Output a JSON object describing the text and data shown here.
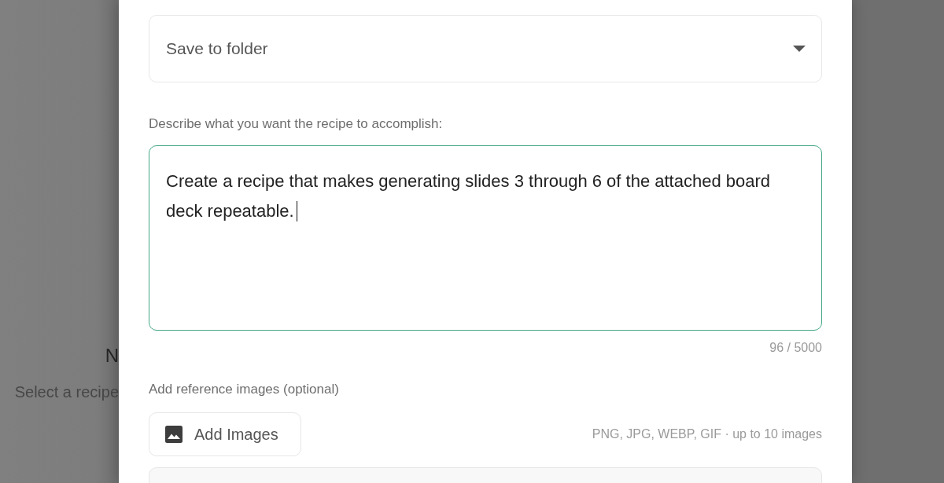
{
  "backdrop": {
    "heading": "N",
    "text": "Select a recipe"
  },
  "dialog": {
    "folder_select": {
      "placeholder": "Save to folder"
    },
    "description": {
      "label": "Describe what you want the recipe to accomplish:",
      "value": "Create a recipe that makes generating slides 3 through 6 of the attached board deck repeatable.",
      "focused": true,
      "counter": "96 / 5000"
    },
    "reference_images": {
      "label": "Add reference images (optional)",
      "button": "Add Images",
      "hint": "PNG, JPG, WEBP, GIF · up to 10 images"
    }
  }
}
